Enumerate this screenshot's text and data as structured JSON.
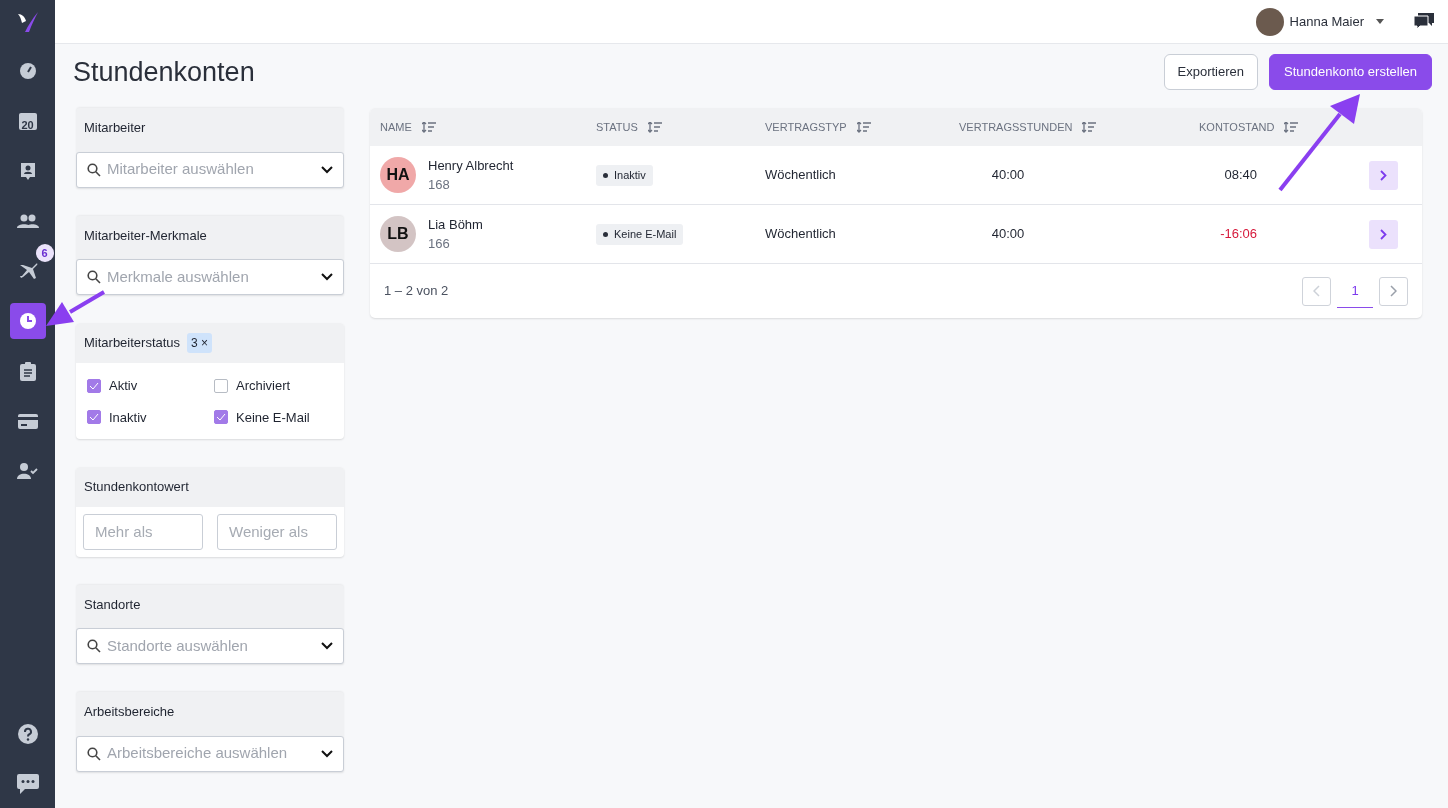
{
  "sidebar": {
    "items": [
      {
        "kind": "gauge",
        "selected": false
      },
      {
        "kind": "calendar",
        "label": "20",
        "selected": false
      },
      {
        "kind": "contact",
        "selected": false
      },
      {
        "kind": "people",
        "selected": false
      },
      {
        "kind": "plane",
        "badge": "6",
        "selected": false
      },
      {
        "kind": "clock",
        "selected": true
      },
      {
        "kind": "clipboard",
        "selected": false
      },
      {
        "kind": "card",
        "selected": false
      },
      {
        "kind": "person-check",
        "selected": false
      }
    ],
    "bottom_items": [
      {
        "kind": "help"
      },
      {
        "kind": "chat"
      }
    ]
  },
  "topbar": {
    "user": "Hanna Maier"
  },
  "page": {
    "title": "Stundenkonten",
    "buttons": [
      {
        "label": "Exportieren",
        "kind": "secondary"
      },
      {
        "label": "Stundenkonto erstellen",
        "kind": "primary"
      }
    ]
  },
  "filters": [
    {
      "kind": "select",
      "label": "Mitarbeiter",
      "placeholder": "Mitarbeiter auswählen"
    },
    {
      "kind": "select",
      "label": "Mitarbeiter-Merkmale",
      "placeholder": "Merkmale auswählen"
    },
    {
      "kind": "checkboxes",
      "label": "Mitarbeiterstatus",
      "badge": "3 ×",
      "options": [
        {
          "label": "Aktiv",
          "checked": true
        },
        {
          "label": "Archiviert",
          "checked": false
        },
        {
          "label": "Inaktiv",
          "checked": true
        },
        {
          "label": "Keine E-Mail",
          "checked": true
        }
      ]
    },
    {
      "kind": "range",
      "label": "Stundenkontowert",
      "placeholders": [
        "Mehr als",
        "Weniger als"
      ]
    },
    {
      "kind": "select",
      "label": "Standorte",
      "placeholder": "Standorte auswählen"
    },
    {
      "kind": "select",
      "label": "Arbeitsbereiche",
      "placeholder": "Arbeitsbereiche auswählen"
    }
  ],
  "table": {
    "columns": [
      "NAME",
      "STATUS",
      "VERTRAGSTYP",
      "VERTRAGSSTUNDEN",
      "KONTOSTAND"
    ],
    "rows": [
      {
        "initials": "HA",
        "color": "#f0a8a8",
        "name": "Henry Albrecht",
        "number": "168",
        "status": "Inaktiv",
        "contract": "Wöchentlich",
        "hours": "40:00",
        "balance": "08:40",
        "negative": false
      },
      {
        "initials": "LB",
        "color": "#d3c4c4",
        "name": "Lia Böhm",
        "number": "166",
        "status": "Keine E-Mail",
        "contract": "Wöchentlich",
        "hours": "40:00",
        "balance": "-16:06",
        "negative": true
      }
    ],
    "range": "1 – 2 von 2",
    "pages": [
      {
        "label": "1",
        "selected": true
      }
    ],
    "prev_disabled": true,
    "next_disabled": false
  }
}
